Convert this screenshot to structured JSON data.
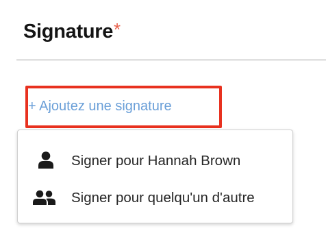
{
  "section": {
    "title": "Signature",
    "required_marker": "*",
    "required_color": "#e8604b"
  },
  "add_signature": {
    "label": "+ Ajoutez une signature",
    "link_color": "#6a9fd8",
    "highlight_color": "#e8311f"
  },
  "menu": {
    "items": [
      {
        "label": "Signer pour Hannah Brown",
        "icon": "user-icon"
      },
      {
        "label": "Signer pour quelqu'un d'autre",
        "icon": "users-icon"
      }
    ]
  }
}
